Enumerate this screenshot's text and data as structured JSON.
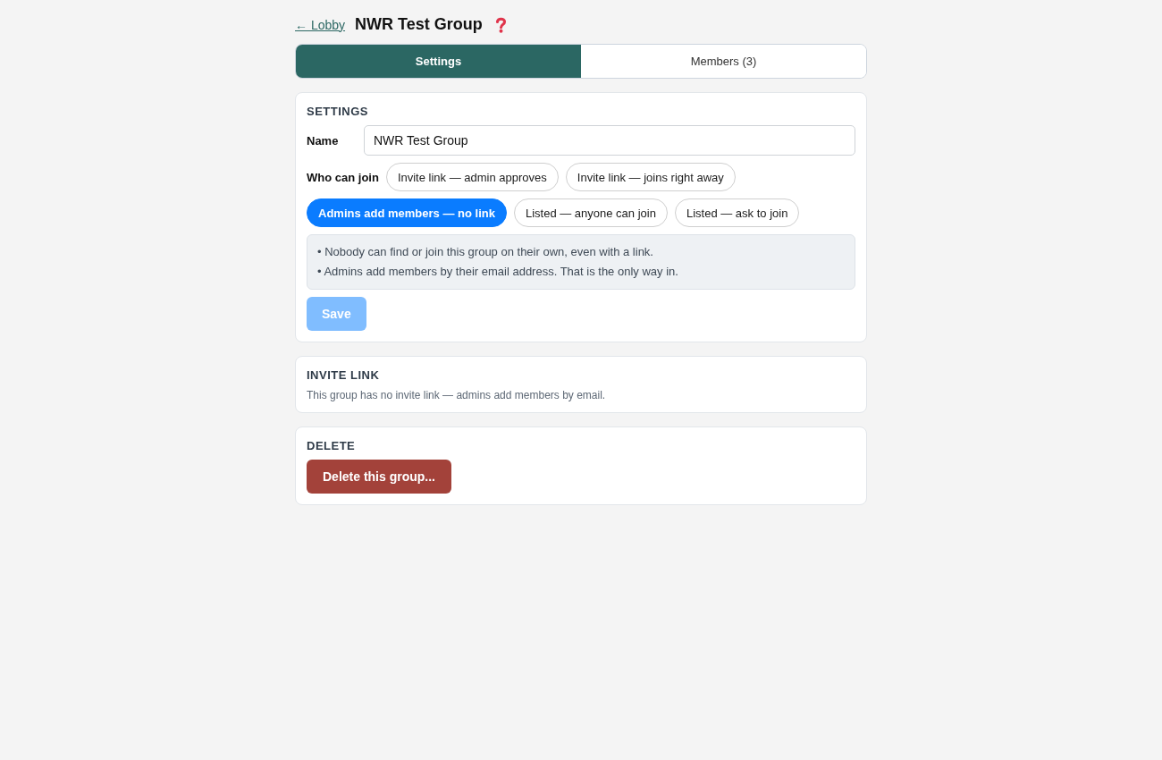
{
  "header": {
    "back_link": "← Lobby",
    "title": "NWR Test Group"
  },
  "tabs": [
    {
      "label": "Settings",
      "selected": true
    },
    {
      "label": "Members (3)",
      "selected": false
    }
  ],
  "settings": {
    "heading": "SETTINGS",
    "name_label": "Name",
    "name_value": "NWR Test Group",
    "join_label": "Who can join",
    "join_options": [
      {
        "label": "Invite link — admin approves",
        "selected": false
      },
      {
        "label": "Invite link — joins right away",
        "selected": false
      },
      {
        "label": "Admins add members — no link",
        "selected": true
      },
      {
        "label": "Listed — anyone can join",
        "selected": false
      },
      {
        "label": "Listed — ask to join",
        "selected": false
      }
    ],
    "notes": [
      "• Nobody can find or join this group on their own, even with a link.",
      "• Admins add members by their email address. That is the only way in."
    ],
    "save_button": {
      "label": "Save",
      "disabled": true
    }
  },
  "invite_link": {
    "heading": "INVITE LINK",
    "text": "This group has no invite link — admins add members by email."
  },
  "delete": {
    "heading": "DELETE",
    "button": "Delete this group..."
  }
}
